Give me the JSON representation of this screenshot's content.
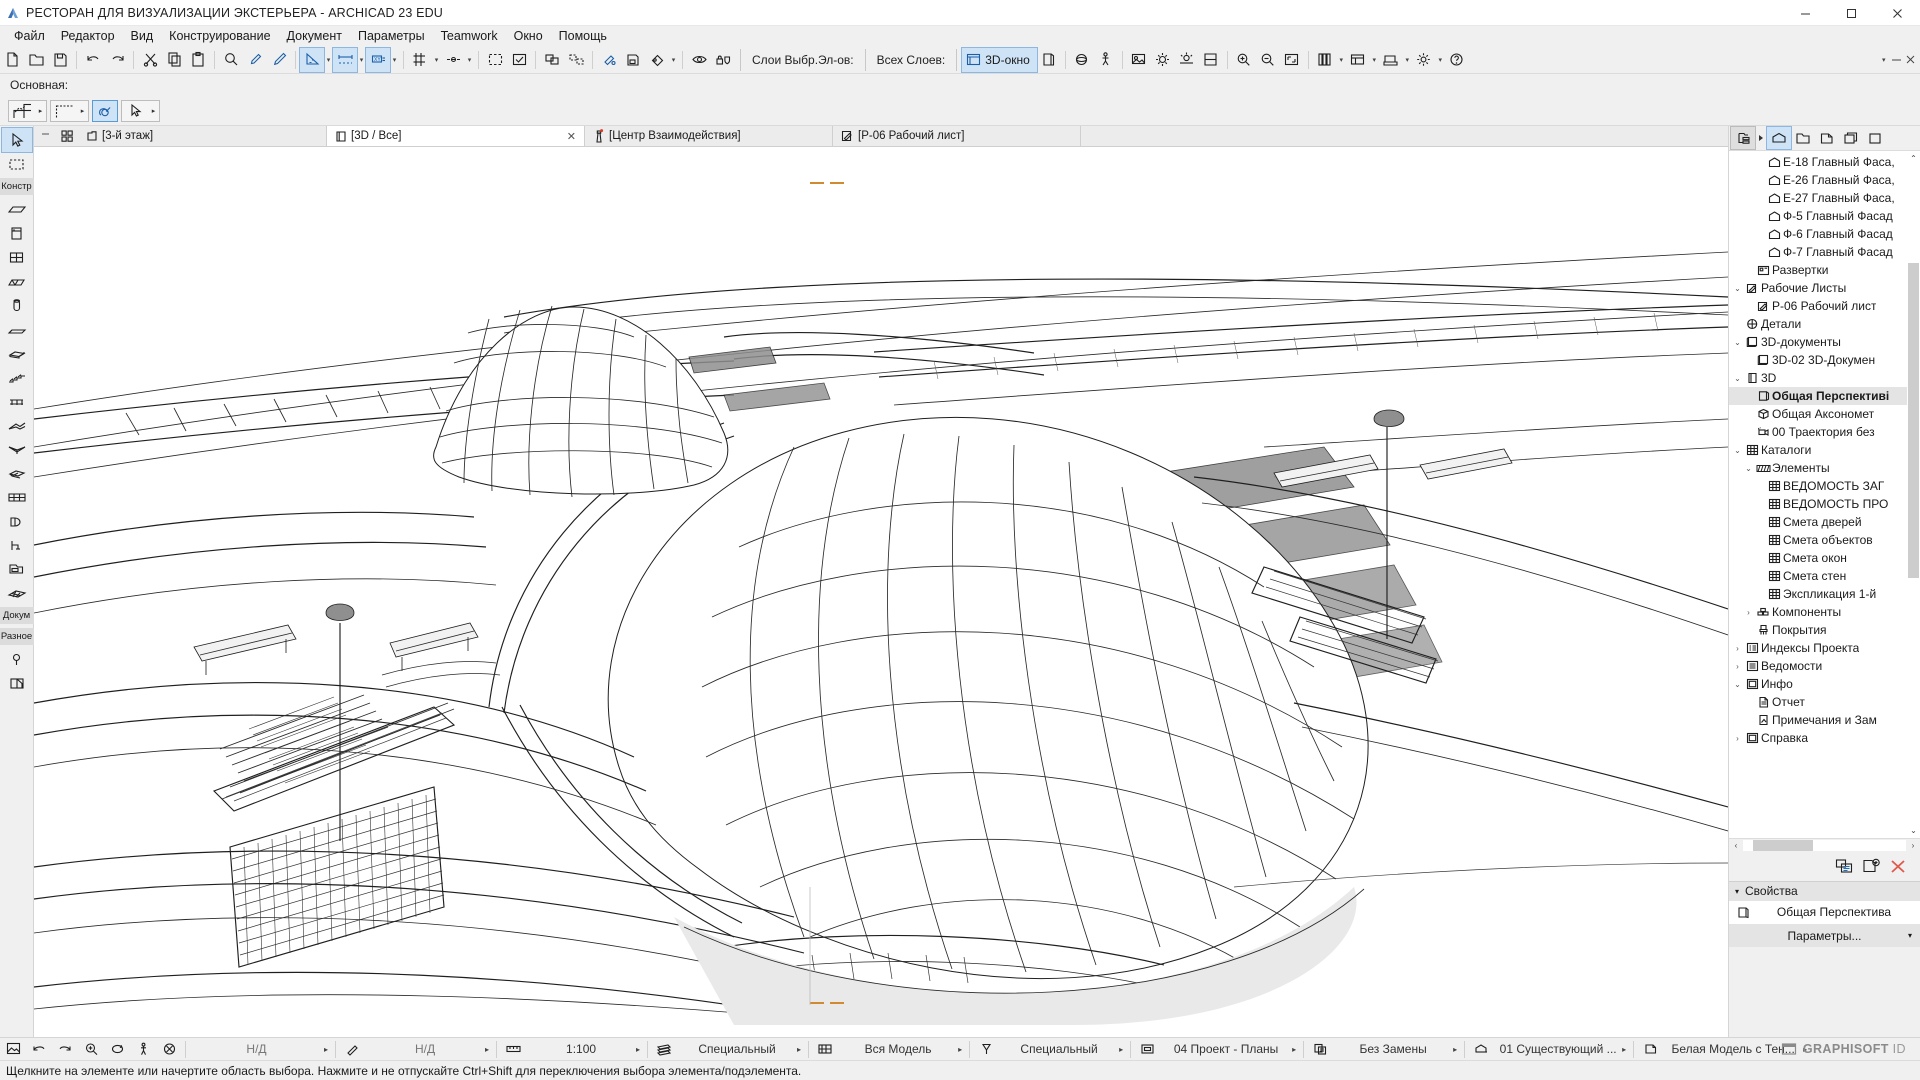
{
  "window": {
    "title": "РЕСТОРАН ДЛЯ ВИЗУАЛИЗАЦИИ ЭКСТЕРЬЕРА - ARCHICAD 23 EDU",
    "minimize": "—",
    "maximize": "❐",
    "close": "✕"
  },
  "menu": {
    "items": [
      {
        "label": "Файл"
      },
      {
        "label": "Редактор"
      },
      {
        "label": "Вид"
      },
      {
        "label": "Конструирование"
      },
      {
        "label": "Документ"
      },
      {
        "label": "Параметры"
      },
      {
        "label": "Teamwork"
      },
      {
        "label": "Окно"
      },
      {
        "label": "Помощь"
      }
    ]
  },
  "toolbar": {
    "layers_selected_label": "Слои Выбр.Эл-ов:",
    "all_layers_label": "Всех Слоев:",
    "window3d_label": "3D-окно",
    "caret": "▾"
  },
  "optionbar": {
    "title": "Основная:"
  },
  "left_toolbox": {
    "group_constr": "Констр",
    "group_docum": "Докум",
    "group_misc": "Разное"
  },
  "tabs": [
    {
      "label": "[3-й этаж]",
      "icon": "storey-icon",
      "active": false,
      "closable": false
    },
    {
      "label": "[3D / Все]",
      "icon": "3d-icon",
      "active": true,
      "closable": true,
      "close": "✕"
    },
    {
      "label": "[Центр Взаимодействия]",
      "icon": "interaction-center-icon",
      "active": false,
      "closable": false
    },
    {
      "label": "[Р-06 Рабочий лист]",
      "icon": "worksheet-icon",
      "active": false,
      "closable": false
    }
  ],
  "navigator": {
    "scroll_up": "⌃",
    "scroll_down": "⌄",
    "scroll_left": "‹",
    "scroll_right": "›",
    "tree": [
      {
        "label": "Е-18 Главный Фаса,",
        "icon": "elevation-icon",
        "indent": 3,
        "twisty": "",
        "selected": false
      },
      {
        "label": "Е-26 Главный Фаса,",
        "icon": "elevation-icon",
        "indent": 3,
        "twisty": "",
        "selected": false
      },
      {
        "label": "Е-27 Главный Фаса,",
        "icon": "elevation-icon",
        "indent": 3,
        "twisty": "",
        "selected": false
      },
      {
        "label": "Ф-5 Главный Фасад",
        "icon": "elevation-icon",
        "indent": 3,
        "twisty": "",
        "selected": false
      },
      {
        "label": "Ф-6 Главный Фасад",
        "icon": "elevation-icon",
        "indent": 3,
        "twisty": "",
        "selected": false
      },
      {
        "label": "Ф-7 Главный Фасад",
        "icon": "elevation-icon",
        "indent": 3,
        "twisty": "",
        "selected": false
      },
      {
        "label": "Развертки",
        "icon": "interior-elevation-icon",
        "indent": 2,
        "twisty": "",
        "selected": false
      },
      {
        "label": "Рабочие Листы",
        "icon": "worksheet-icon",
        "indent": 1,
        "twisty": "⌄",
        "selected": false
      },
      {
        "label": "Р-06 Рабочий лист",
        "icon": "worksheet-icon",
        "indent": 2,
        "twisty": "",
        "selected": false
      },
      {
        "label": "Детали",
        "icon": "detail-icon",
        "indent": 1,
        "twisty": "",
        "selected": false
      },
      {
        "label": "3D-документы",
        "icon": "3d-document-icon",
        "indent": 1,
        "twisty": "⌄",
        "selected": false
      },
      {
        "label": "3D-02 3D-Докумен",
        "icon": "3d-document-icon",
        "indent": 2,
        "twisty": "",
        "selected": false
      },
      {
        "label": "3D",
        "icon": "3d-icon",
        "indent": 1,
        "twisty": "⌄",
        "selected": false
      },
      {
        "label": "Общая Перспективі",
        "icon": "perspective-icon",
        "indent": 2,
        "twisty": "",
        "selected": true
      },
      {
        "label": "Общая Аксономет",
        "icon": "axonometry-icon",
        "indent": 2,
        "twisty": "",
        "selected": false
      },
      {
        "label": "00 Траектория без",
        "icon": "camera-path-icon",
        "indent": 2,
        "twisty": "",
        "selected": false
      },
      {
        "label": "Каталоги",
        "icon": "schedule-icon",
        "indent": 1,
        "twisty": "⌄",
        "selected": false
      },
      {
        "label": "Элементы",
        "icon": "elements-icon",
        "indent": 2,
        "twisty": "⌄",
        "selected": false
      },
      {
        "label": "ВЕДОМОСТЬ ЗАГ",
        "icon": "schedule-icon",
        "indent": 3,
        "twisty": "",
        "selected": false
      },
      {
        "label": "ВЕДОМОСТЬ ПРО",
        "icon": "schedule-icon",
        "indent": 3,
        "twisty": "",
        "selected": false
      },
      {
        "label": "Смета дверей",
        "icon": "schedule-icon",
        "indent": 3,
        "twisty": "",
        "selected": false
      },
      {
        "label": "Смета объектов",
        "icon": "schedule-icon",
        "indent": 3,
        "twisty": "",
        "selected": false
      },
      {
        "label": "Смета окон",
        "icon": "schedule-icon",
        "indent": 3,
        "twisty": "",
        "selected": false
      },
      {
        "label": "Смета стен",
        "icon": "schedule-icon",
        "indent": 3,
        "twisty": "",
        "selected": false
      },
      {
        "label": "Экспликация 1-й",
        "icon": "schedule-icon",
        "indent": 3,
        "twisty": "",
        "selected": false
      },
      {
        "label": "Компоненты",
        "icon": "components-icon",
        "indent": 2,
        "twisty": "›",
        "selected": false
      },
      {
        "label": "Покрытия",
        "icon": "surfaces-icon",
        "indent": 2,
        "twisty": "",
        "selected": false
      },
      {
        "label": "Индексы Проекта",
        "icon": "project-index-icon",
        "indent": 1,
        "twisty": "›",
        "selected": false
      },
      {
        "label": "Ведомости",
        "icon": "lists-icon",
        "indent": 1,
        "twisty": "›",
        "selected": false
      },
      {
        "label": "Инфо",
        "icon": "info-icon",
        "indent": 1,
        "twisty": "⌄",
        "selected": false
      },
      {
        "label": "Отчет",
        "icon": "report-icon",
        "indent": 2,
        "twisty": "",
        "selected": false
      },
      {
        "label": "Примечания и Зам",
        "icon": "notes-icon",
        "indent": 2,
        "twisty": "",
        "selected": false
      },
      {
        "label": "Справка",
        "icon": "help-icon",
        "indent": 1,
        "twisty": "›",
        "selected": false
      }
    ],
    "properties_header": "Свойства",
    "properties_value": "Общая Перспектива",
    "params_button": "Параметры...",
    "params_caret": "▾",
    "section_caret": "▾"
  },
  "statusbar": {
    "items": [
      {
        "name": "zoom-na-1",
        "value": "Н/Д",
        "caret": "▸",
        "dim": true
      },
      {
        "name": "zoom-na-2",
        "value": "Н/Д",
        "caret": "▸",
        "dim": true
      },
      {
        "name": "scale",
        "value": "1:100",
        "caret": "▸",
        "dim": false
      },
      {
        "name": "pen-set",
        "value": "Специальный",
        "caret": "▸",
        "dim": false
      },
      {
        "name": "structure",
        "value": "Вся Модель",
        "caret": "▸",
        "dim": false
      },
      {
        "name": "partial-structure",
        "value": "Специальный",
        "caret": "▸",
        "dim": false
      },
      {
        "name": "layer-combination",
        "value": "04 Проект - Планы",
        "caret": "▸",
        "dim": false
      },
      {
        "name": "graphic-override",
        "value": "Без Замены",
        "caret": "▸",
        "dim": false
      },
      {
        "name": "renovation-filter",
        "value": "01 Существующий ...",
        "caret": "▸",
        "dim": false
      },
      {
        "name": "3d-style",
        "value": "Белая Модель с Тен...",
        "caret": "▸",
        "dim": false
      }
    ],
    "prompt": "Щелкните на элементе или начертите область выбора. Нажмите и не отпускайте Ctrl+Shift для переключения выбора элемента/подэлемента.",
    "graphisoft_id_pre": "GRAPHISOFT",
    "graphisoft_id_post": " ID"
  }
}
